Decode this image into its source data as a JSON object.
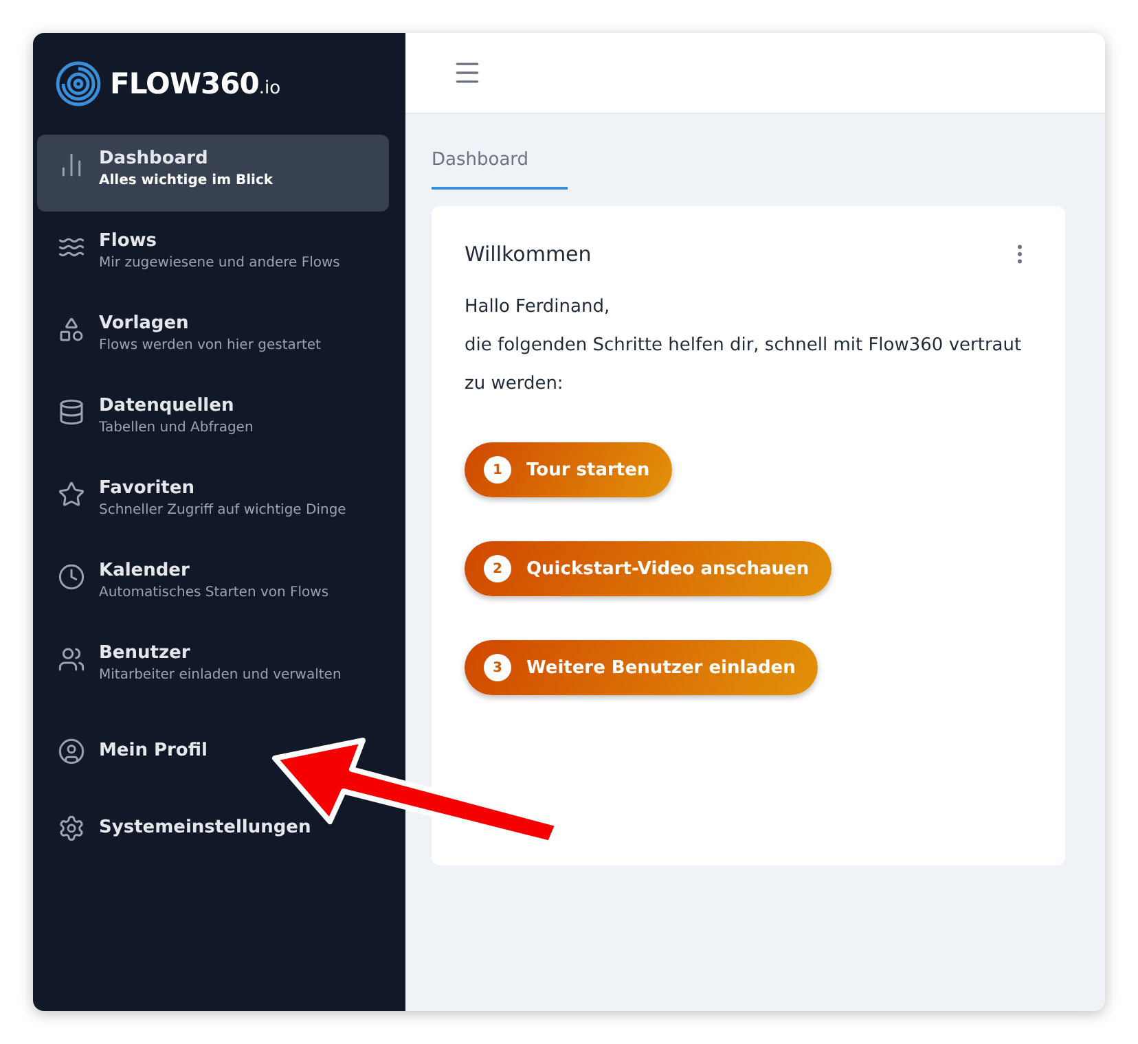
{
  "logo": {
    "name": "FLOW360",
    "suffix": ".io"
  },
  "sidebar": {
    "items": [
      {
        "label": "Dashboard",
        "subtitle": "Alles wichtige im Blick",
        "selected": true
      },
      {
        "label": "Flows",
        "subtitle": "Mir zugewiesene und andere Flows",
        "selected": false
      },
      {
        "label": "Vorlagen",
        "subtitle": "Flows werden von hier gestartet",
        "selected": false
      },
      {
        "label": "Datenquellen",
        "subtitle": "Tabellen und Abfragen",
        "selected": false
      },
      {
        "label": "Favoriten",
        "subtitle": "Schneller Zugriff auf wichtige Dinge",
        "selected": false
      },
      {
        "label": "Kalender",
        "subtitle": "Automatisches Starten von Flows",
        "selected": false
      },
      {
        "label": "Benutzer",
        "subtitle": "Mitarbeiter einladen und verwalten",
        "selected": false
      },
      {
        "label": "Mein Profil",
        "selected": false
      },
      {
        "label": "Systemeinstellungen",
        "selected": false
      }
    ]
  },
  "tabs": [
    {
      "label": "Dashboard",
      "selected": true
    }
  ],
  "card": {
    "title": "Willkommen",
    "lines": [
      "Hallo Ferdinand,",
      "die folgenden Schritte helfen dir, schnell mit Flow360 vertraut zu werden:"
    ],
    "steps": [
      {
        "number": "1",
        "label": "Tour starten"
      },
      {
        "number": "2",
        "label": "Quickstart-Video anschauen"
      },
      {
        "number": "3",
        "label": "Weitere Benutzer einladen"
      }
    ]
  },
  "annotation": {
    "kind": "arrow"
  }
}
